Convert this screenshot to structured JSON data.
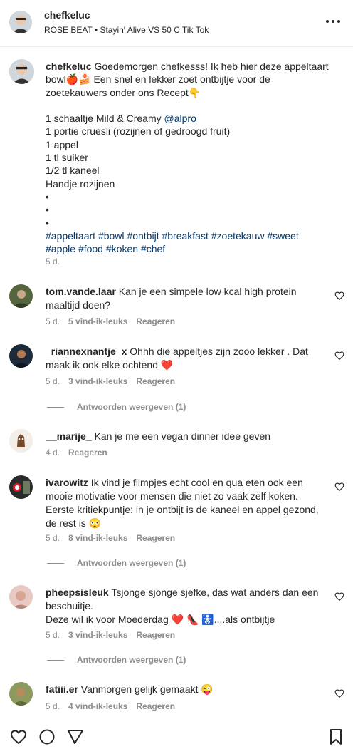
{
  "header": {
    "username": "chefkeluc",
    "audio": "ROSE BEAT • Stayin' Alive VS 50 C Tik Tok"
  },
  "caption": {
    "username": "chefkeluc",
    "line1": " Goedemorgen chefkesss! Ik heb hier deze appeltaart bowl🍎🍰 Een snel en lekker zoet ontbijtje voor de zoetekauwers onder ons Recept👇\n\n1 schaaltje Mild & Creamy ",
    "mention": "@alpro",
    "line2": "\n1 portie cruesli (rozijnen of gedroogd fruit)\n1 appel\n1 tl suiker\n1/2 tl kaneel\nHandje rozijnen\n•\n•\n•\n",
    "hashtags": [
      "#appeltaart",
      "#bowl",
      "#ontbijt",
      "#breakfast",
      "#zoetekauw",
      "#sweet",
      "#apple",
      "#food",
      "#koken",
      "#chef"
    ],
    "time": "5 d."
  },
  "comments": [
    {
      "username": "tom.vande.laar",
      "text": "Kan je een simpele low kcal high protein maaltijd doen?",
      "time": "5 d.",
      "likes": "5 vind-ik-leuks",
      "reply": "Reageren",
      "replies": ""
    },
    {
      "username": "_riannexnantje_x",
      "text": "Ohhh die appeltjes zijn zooo lekker . Dat maak ik ook elke ochtend ❤️",
      "time": "5 d.",
      "likes": "3 vind-ik-leuks",
      "reply": "Reageren",
      "replies": "Antwoorden weergeven (1)"
    },
    {
      "username": "__marije_",
      "text": "Kan je me een vegan dinner idee geven",
      "time": "4 d.",
      "likes": "",
      "reply": "Reageren",
      "replies": ""
    },
    {
      "username": "ivarowitz",
      "text": "Ik vind je filmpjes echt cool en qua eten ook een mooie motivatie voor mensen die niet zo vaak zelf koken. Eerste kritiekpuntje: in je ontbijt is de kaneel en appel gezond, de rest is 😳",
      "time": "5 d.",
      "likes": "8 vind-ik-leuks",
      "reply": "Reageren",
      "replies": "Antwoorden weergeven (1)"
    },
    {
      "username": "pheepsisleuk",
      "text": "Tsjonge sjonge sjefke, das wat anders dan een beschuitje.\nDeze wil ik voor Moederdag ❤️ 👠 🚼....als ontbijtje",
      "time": "5 d.",
      "likes": "3 vind-ik-leuks",
      "reply": "Reageren",
      "replies": "Antwoorden weergeven (1)"
    },
    {
      "username": "fatiii.er",
      "text": "Vanmorgen gelijk gemaakt 😜",
      "time": "5 d.",
      "likes": "4 vind-ik-leuks",
      "reply": "Reageren",
      "replies": ""
    }
  ]
}
